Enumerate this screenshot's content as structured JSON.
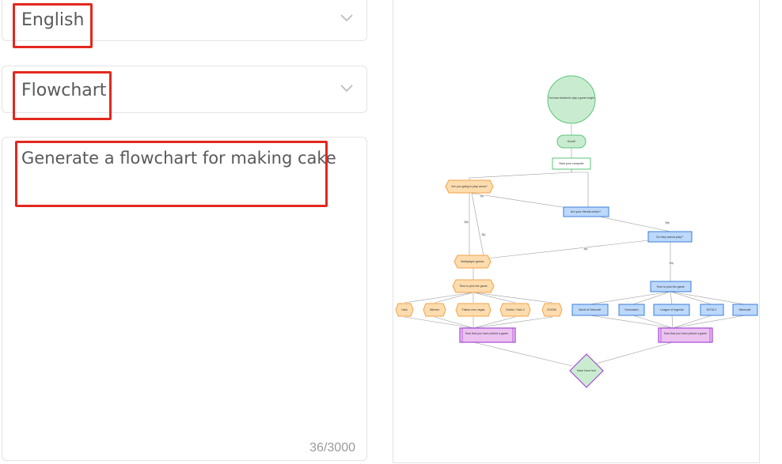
{
  "language_select": {
    "value": "English"
  },
  "type_select": {
    "value": "Flowchart"
  },
  "prompt": {
    "text": "Generate a flowchart for making cake",
    "counter": "36/3000"
  },
  "colors": {
    "highlight": "#e3281e",
    "green_fill": "#c9ecd0",
    "green_stroke": "#59c47a",
    "orange_fill": "#fddcae",
    "orange_stroke": "#f2a24a",
    "blue_fill": "#bcd8fb",
    "blue_stroke": "#3b7fd8",
    "purple_fill": "#ecc3f0",
    "purple_stroke": "#a64ad6"
  },
  "flowchart": {
    "start": "You have decided to play a game tonight",
    "good": "Good!!",
    "start_computer": "Start your computer",
    "play_alone": "Are you going to play alone?",
    "favorite_friends": "Are your friends online?",
    "wanna_play": "Do they wanna play?",
    "multiplayer": "Multiplayer games",
    "pick_game": "Time to pick the game",
    "pick_game_right": "Time to pick the game",
    "left_games": [
      "Halo",
      "Witcher",
      "Fallout new vegas",
      "Gothic / Halo 2",
      "DOOM"
    ],
    "right_games": [
      "World of Warcraft",
      "Overwatch",
      "League of legends",
      "DOTA 2",
      "Minecraft"
    ],
    "chosen_left": "Now that you have picked a game",
    "chosen_right": "Now that you have picked a game",
    "end": "Have have fun!",
    "edge_labels": [
      "No",
      "Yes",
      "No",
      "Yes",
      "No",
      "Yes"
    ]
  }
}
